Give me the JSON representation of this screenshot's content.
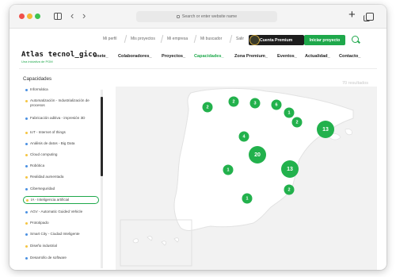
{
  "browser": {
    "address": "Search or enter website name"
  },
  "utility": {
    "links": [
      "Mi perfil",
      "Mis proyectos",
      "Mi empresa",
      "Mi buscador",
      "Salir"
    ],
    "premium_label": "Cuenta Premium",
    "start_label": "Iniciar proyecto"
  },
  "brand": {
    "title": "Atlas tecnol_gico",
    "subtitle": "Una iniciativa de PGM"
  },
  "nav": {
    "items": [
      "Únete_",
      "Colaboradores_",
      "Proyectos_",
      "Capacidades_",
      "Zona Premium_",
      "Eventos_",
      "Actualidad_",
      "Contacto_"
    ],
    "active_index": 3
  },
  "filters": {
    "title": "Capacidades",
    "results": "70 resultados",
    "items": [
      {
        "label": "Informática",
        "color": "#4a90e2"
      },
      {
        "label": "Automatización - Industrialización de procesos",
        "color": "#f5c542"
      },
      {
        "label": "Fabricación aditiva - impresión 3D",
        "color": "#4a90e2"
      },
      {
        "label": "IoT - Internet of things",
        "color": "#f5c542"
      },
      {
        "label": "Análisis de datos - Big Data",
        "color": "#4a90e2"
      },
      {
        "label": "Cloud computing",
        "color": "#f5c542"
      },
      {
        "label": "Robótica",
        "color": "#4a90e2"
      },
      {
        "label": "Realidad aumentada",
        "color": "#f5c542"
      },
      {
        "label": "Ciberseguridad",
        "color": "#4a90e2"
      },
      {
        "label": "IA - Inteligencia artificial",
        "color": "#f5c542"
      },
      {
        "label": "AGV - Automatic Guided Vehicle",
        "color": "#4a90e2"
      },
      {
        "label": "Prototipado",
        "color": "#f5c542"
      },
      {
        "label": "Smart City - Ciudad Inteligente",
        "color": "#4a90e2"
      },
      {
        "label": "Diseño industrial",
        "color": "#f5c542"
      },
      {
        "label": "Desarrollo de software",
        "color": "#4a90e2"
      }
    ],
    "selected_index": 9
  },
  "map": {
    "markers": [
      "2",
      "2",
      "3",
      "6",
      "1",
      "2",
      "13",
      "4",
      "20",
      "1",
      "13",
      "2",
      "1"
    ],
    "accent": "#22b14c"
  }
}
